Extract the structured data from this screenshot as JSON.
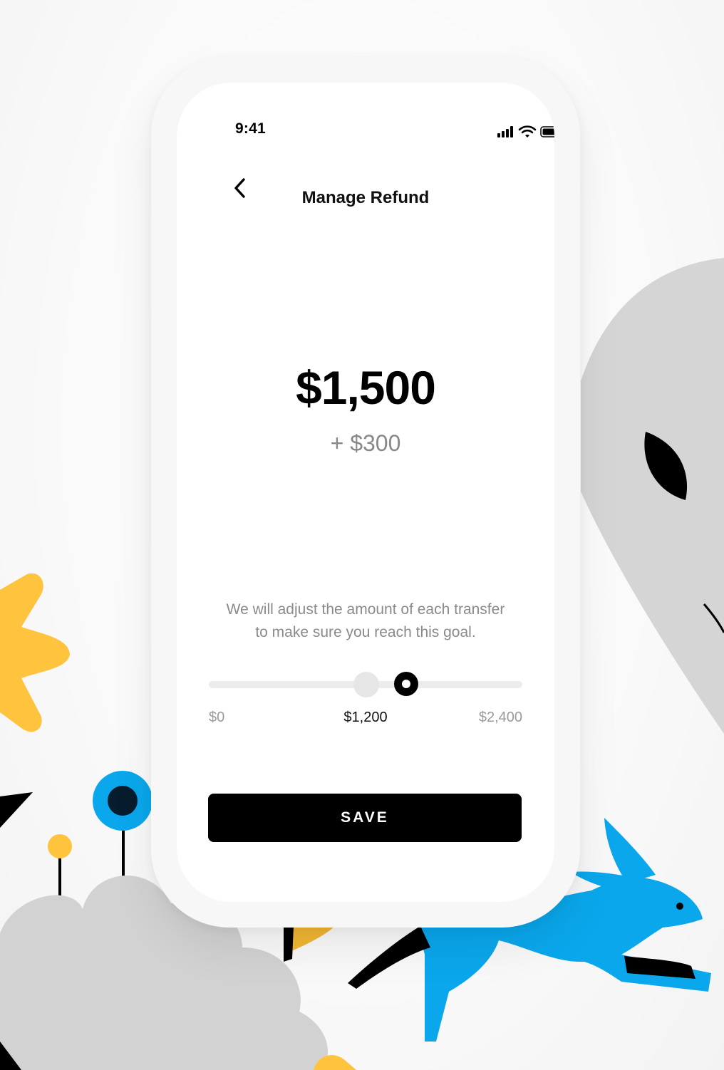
{
  "status_bar": {
    "time": "9:41",
    "icons": [
      "cellular-signal-icon",
      "wifi-icon",
      "battery-icon"
    ]
  },
  "header": {
    "title": "Manage Refund",
    "back_icon": "chevron-left-icon"
  },
  "refund": {
    "amount": "$1,500",
    "difference": "+ $300",
    "description": "We will adjust the amount of each transfer to make sure you reach this goal."
  },
  "slider": {
    "min_label": "$0",
    "mid_label": "$1,200",
    "max_label": "$2,400",
    "min": 0,
    "max": 2400,
    "previous_value": 1200,
    "value": 1500
  },
  "actions": {
    "save_label": "SAVE"
  },
  "colors": {
    "accent": "#000000",
    "track": "#ececec",
    "muted_text": "#8a8a8a",
    "illustration_yellow": "#ffc33d",
    "illustration_blue": "#0aa7ec",
    "illustration_gray": "#d4d4d4"
  }
}
